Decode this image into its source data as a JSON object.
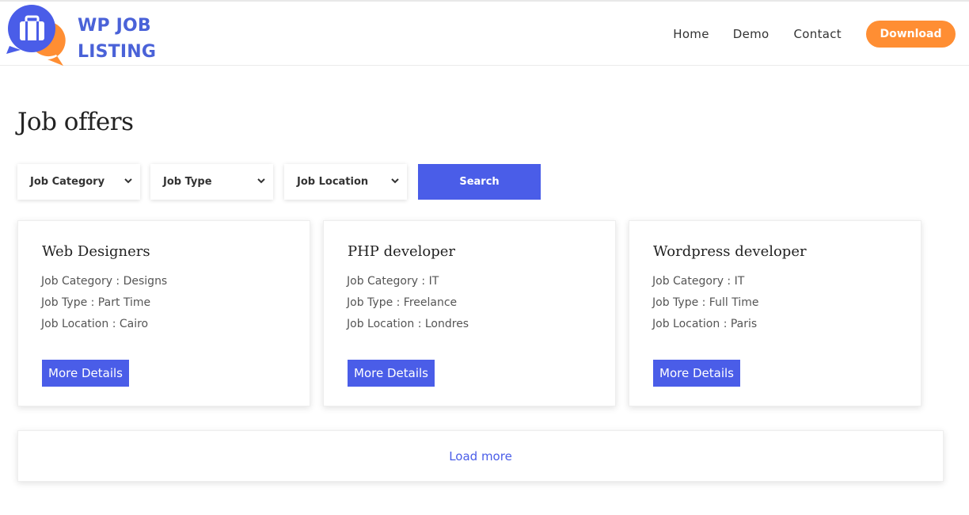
{
  "brand": {
    "line1": "WP JOB",
    "line2": "LISTING",
    "logo_icon": "briefcase-chat-bubble-icon",
    "colors": {
      "blue": "#4a62d8",
      "orange": "#ff8e33"
    }
  },
  "nav": {
    "home": "Home",
    "demo": "Demo",
    "contact": "Contact",
    "download": "Download"
  },
  "page": {
    "title": "Job offers"
  },
  "filters": {
    "category": "Job Category",
    "type": "Job Type",
    "location": "Job Location",
    "search": "Search",
    "chevron_icon": "chevron-down-icon"
  },
  "jobs": [
    {
      "title": "Web Designers",
      "category": "Job Category : Designs",
      "type": "Job Type : Part Time",
      "location": "Job Location : Cairo",
      "button": "More Details"
    },
    {
      "title": "PHP developer",
      "category": "Job Category : IT",
      "type": "Job Type : Freelance",
      "location": "Job Location : Londres",
      "button": "More Details"
    },
    {
      "title": "Wordpress developer",
      "category": "Job Category : IT",
      "type": "Job Type : Full Time",
      "location": "Job Location : Paris",
      "button": "More Details"
    }
  ],
  "load_more": "Load more",
  "accent_color": "#4a5de8"
}
